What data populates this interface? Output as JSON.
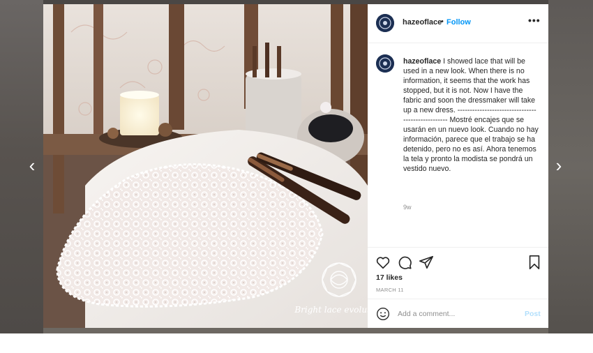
{
  "post": {
    "username": "hazeoflace",
    "separator": "•",
    "follow_label": "Follow",
    "more_icon": "more-options-icon",
    "caption": "I showed lace that will be used in a new look. When there is no information, it seems that the work has stopped, but it is not. Now I have the fabric and soon the dressmaker will take up a new dress. -------------------------------------------------- Mostré encajes que se usarán en un nuevo look. Cuando no hay información, parece que el trabajo se ha detenido, pero no es así. Ahora tenemos la tela y pronto la modista se pondrá un vestido nuevo.",
    "time_ago": "9w",
    "likes": "17 likes",
    "date": "MARCH 11"
  },
  "photo": {
    "watermark_text": "Bright lace evolution"
  },
  "comment_box": {
    "placeholder": "Add a comment...",
    "post_label": "Post"
  },
  "navigation": {
    "prev_glyph": "‹",
    "next_glyph": "›"
  },
  "colors": {
    "link_blue": "#0095f6",
    "post_disabled": "#b2dffc",
    "avatar_navy": "#1c2f53"
  }
}
